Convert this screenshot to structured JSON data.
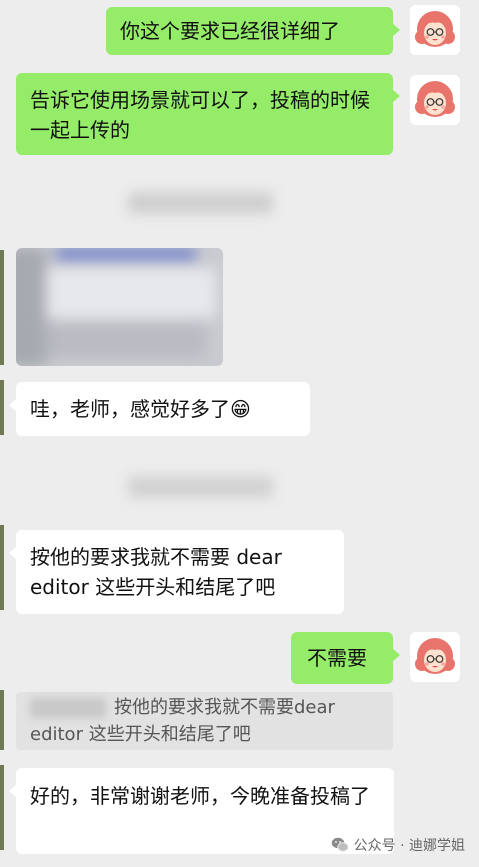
{
  "messages": [
    {
      "text": "你这个要求已经很详细了"
    },
    {
      "text": "告诉它使用场景就可以了，投稿的时候一起上传的"
    },
    {
      "text": "哇，老师，感觉好多了😁"
    },
    {
      "text": "按他的要求我就不需要 dear editor 这些开头和结尾了吧"
    },
    {
      "text": "不需要"
    },
    {
      "quote": "按他的要求我就不需要dear editor 这些开头和结尾了吧"
    },
    {
      "text": "好的，非常谢谢老师，今晚准备投稿了"
    }
  ],
  "footer": {
    "label": "公众号 · 迪娜学姐"
  },
  "colors": {
    "background": "#ededed",
    "sent_bubble": "#95ec69",
    "received_bubble": "#ffffff",
    "quote_box": "#e2e2e2"
  },
  "icons": {
    "avatar": "cartoon-girl-avatar",
    "footer": "wechat-icon"
  }
}
